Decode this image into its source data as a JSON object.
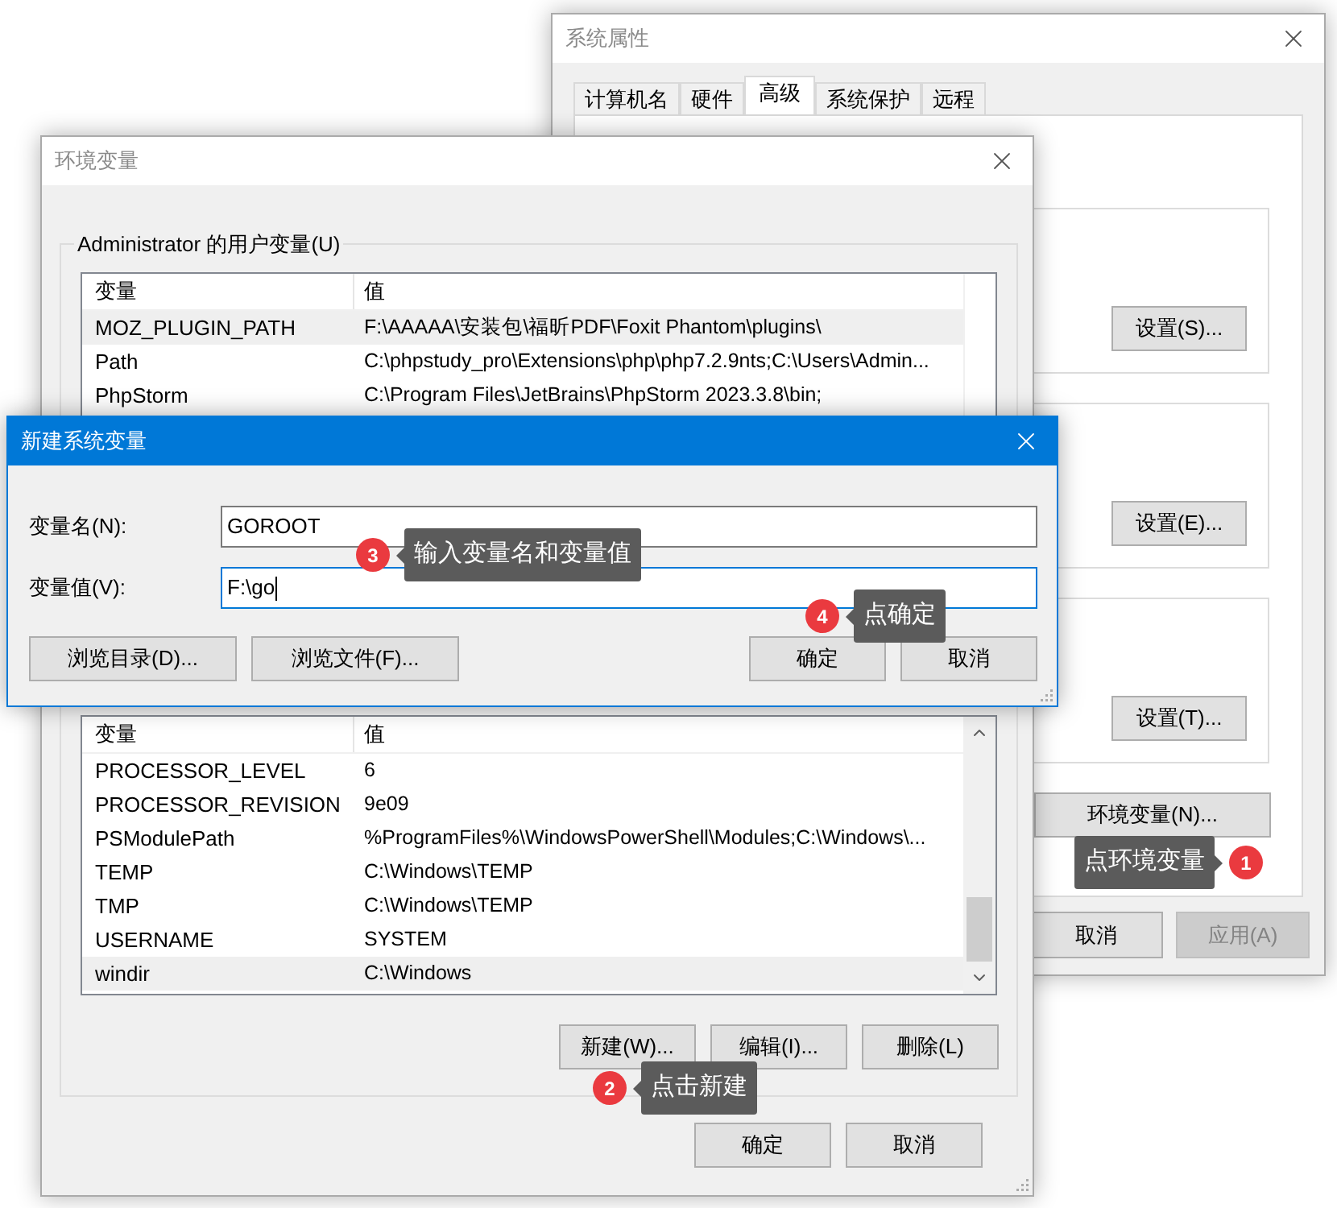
{
  "system_properties": {
    "title": "系统属性",
    "tabs": [
      {
        "label": "计算机名",
        "selected": false
      },
      {
        "label": "硬件",
        "selected": false
      },
      {
        "label": "高级",
        "selected": true
      },
      {
        "label": "系统保护",
        "selected": false
      },
      {
        "label": "远程",
        "selected": false
      }
    ],
    "settings_buttons": [
      "设置(S)...",
      "设置(E)...",
      "设置(T)..."
    ],
    "env_button": "环境变量(N)...",
    "buttons": [
      {
        "label": "取消",
        "disabled": false
      },
      {
        "label": "应用(A)",
        "disabled": true
      }
    ]
  },
  "env_window": {
    "title": "环境变量",
    "user_group": {
      "title": "Administrator 的用户变量(U)",
      "columns": [
        "变量",
        "值"
      ],
      "rows": [
        {
          "name": "MOZ_PLUGIN_PATH",
          "value": "F:\\AAAAA\\安装包\\福昕PDF\\Foxit Phantom\\plugins\\",
          "selected": true
        },
        {
          "name": "Path",
          "value": "C:\\phpstudy_pro\\Extensions\\php\\php7.2.9nts;C:\\Users\\Admin...",
          "selected": false
        },
        {
          "name": "PhpStorm",
          "value": "C:\\Program Files\\JetBrains\\PhpStorm 2023.3.8\\bin;",
          "selected": false
        }
      ]
    },
    "system_table": {
      "columns": [
        "变量",
        "值"
      ],
      "rows": [
        {
          "name": "PROCESSOR_LEVEL",
          "value": "6",
          "selected": false
        },
        {
          "name": "PROCESSOR_REVISION",
          "value": "9e09",
          "selected": false
        },
        {
          "name": "PSModulePath",
          "value": "%ProgramFiles%\\WindowsPowerShell\\Modules;C:\\Windows\\...",
          "selected": false
        },
        {
          "name": "TEMP",
          "value": "C:\\Windows\\TEMP",
          "selected": false
        },
        {
          "name": "TMP",
          "value": "C:\\Windows\\TEMP",
          "selected": false
        },
        {
          "name": "USERNAME",
          "value": "SYSTEM",
          "selected": false
        },
        {
          "name": "windir",
          "value": "C:\\Windows",
          "selected": true
        }
      ]
    },
    "system_buttons": [
      "新建(W)...",
      "编辑(I)...",
      "删除(L)"
    ],
    "footer_buttons": [
      "确定",
      "取消"
    ]
  },
  "new_variable_dialog": {
    "title": "新建系统变量",
    "fields": [
      {
        "label": "变量名(N):",
        "value": "GOROOT",
        "focused": false
      },
      {
        "label": "变量值(V):",
        "value": "F:\\go",
        "focused": true
      }
    ],
    "left_buttons": [
      "浏览目录(D)...",
      "浏览文件(F)..."
    ],
    "right_buttons": [
      "确定",
      "取消"
    ]
  },
  "annotations": [
    {
      "number": "1",
      "text": "点环境变量",
      "kind": "rightward"
    },
    {
      "number": "2",
      "text": "点击新建",
      "kind": "leftward"
    },
    {
      "number": "3",
      "text": "输入变量名和变量值",
      "kind": "leftward"
    },
    {
      "number": "4",
      "text": "点确定",
      "kind": "leftward"
    }
  ]
}
